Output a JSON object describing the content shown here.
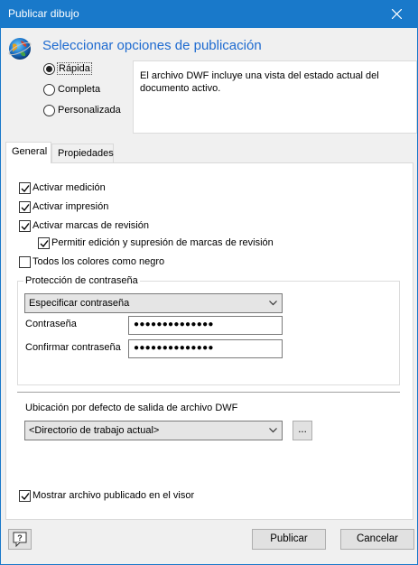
{
  "window": {
    "title": "Publicar dibujo"
  },
  "header": {
    "heading": "Seleccionar opciones de publicación"
  },
  "modes": [
    {
      "label": "Rápida",
      "selected": true
    },
    {
      "label": "Completa",
      "selected": false
    },
    {
      "label": "Personalizada",
      "selected": false
    }
  ],
  "description": "El archivo DWF incluye una vista del estado actual del documento activo.",
  "tabs": [
    {
      "label": "General",
      "active": true
    },
    {
      "label": "Propiedades",
      "active": false
    }
  ],
  "options": {
    "enable_measure": {
      "label": "Activar medición",
      "checked": true
    },
    "enable_print": {
      "label": "Activar impresión",
      "checked": true
    },
    "enable_markup": {
      "label": "Activar marcas de revisión",
      "checked": true
    },
    "allow_edit_markup": {
      "label": "Permitir edición y supresión de marcas de revisión",
      "checked": true
    },
    "all_black": {
      "label": "Todos los colores como negro",
      "checked": false
    }
  },
  "password": {
    "group_title": "Protección de contraseña",
    "mode_value": "Especificar contraseña",
    "password_label": "Contraseña",
    "password_value": "●●●●●●●●●●●●●●",
    "confirm_label": "Confirmar contraseña",
    "confirm_value": "●●●●●●●●●●●●●●"
  },
  "output": {
    "label": "Ubicación por defecto de salida de archivo DWF",
    "value": "<Directorio de trabajo actual>",
    "browse_label": "..."
  },
  "show_published": {
    "label": "Mostrar archivo publicado en el visor",
    "checked": true
  },
  "buttons": {
    "publish": "Publicar",
    "cancel": "Cancelar"
  },
  "icons": {
    "globe": "globe-icon",
    "help": "help-icon",
    "close": "close-icon"
  },
  "colors": {
    "titlebar": "#1979ca",
    "heading": "#1d6ad0"
  }
}
